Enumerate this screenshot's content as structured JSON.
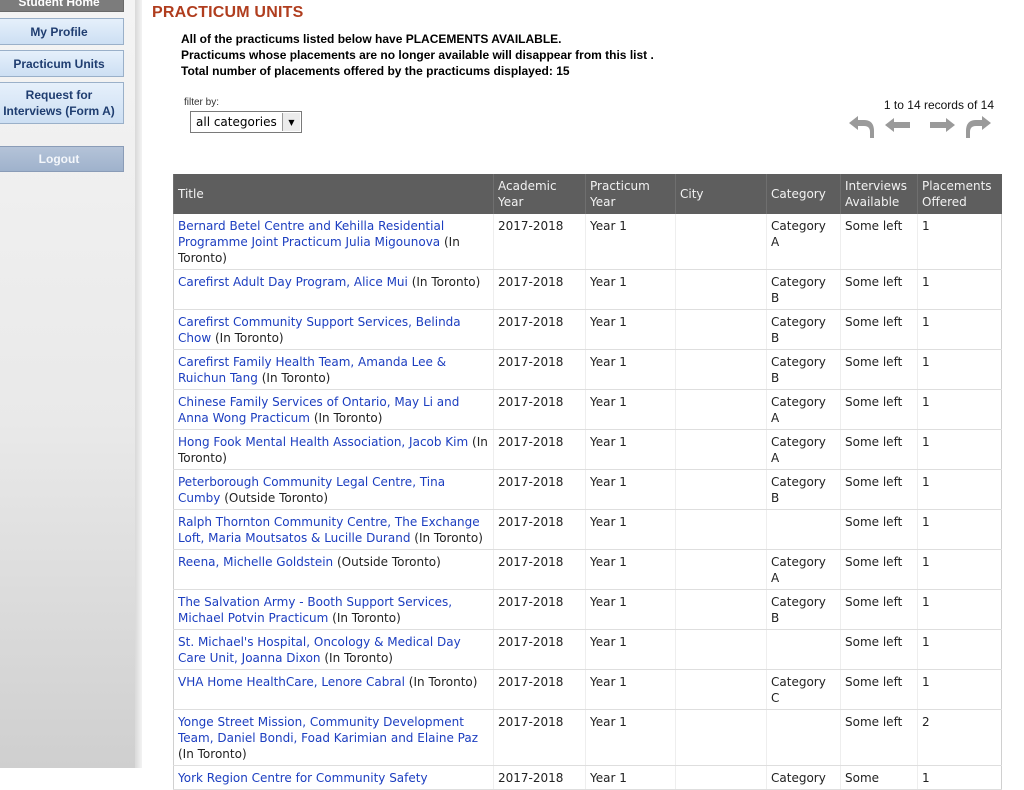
{
  "sidebar": {
    "items": [
      {
        "label": "Student Home"
      },
      {
        "label": "My Profile"
      },
      {
        "label": "Practicum Units"
      },
      {
        "label": "Request for Interviews (Form A)"
      },
      {
        "label": "Logout"
      }
    ]
  },
  "page": {
    "title": "PRACTICUM UNITS",
    "intro": [
      "All of the practicums listed below have PLACEMENTS AVAILABLE.",
      "Practicums whose placements are no longer available will disappear from this list .",
      "Total number of placements offered by the practicums displayed: 15"
    ]
  },
  "filter": {
    "label": "filter by:",
    "selected": "all categories"
  },
  "pager": {
    "records_text": "1 to 14 records of 14",
    "icons": [
      "first-page-icon",
      "previous-page-icon",
      "next-page-icon",
      "last-page-icon"
    ]
  },
  "table": {
    "headers": [
      "Title",
      "Academic Year",
      "Practicum Year",
      "City",
      "Category",
      "Interviews Available",
      "Placements Offered"
    ],
    "rows": [
      {
        "title": "Bernard Betel Centre and Kehilla Residential Programme Joint Practicum Julia Migounova",
        "location": "(In Toronto)",
        "academic_year": "2017-2018",
        "practicum_year": "Year 1",
        "city": "",
        "category": "Category A",
        "interviews": "Some left",
        "placements": "1"
      },
      {
        "title": "Carefirst Adult Day Program, Alice Mui",
        "location": "(In Toronto)",
        "academic_year": "2017-2018",
        "practicum_year": "Year 1",
        "city": "",
        "category": "Category B",
        "interviews": "Some left",
        "placements": "1"
      },
      {
        "title": "Carefirst Community Support Services, Belinda Chow",
        "location": "(In Toronto)",
        "academic_year": "2017-2018",
        "practicum_year": "Year 1",
        "city": "",
        "category": "Category B",
        "interviews": "Some left",
        "placements": "1"
      },
      {
        "title": "Carefirst Family Health Team, Amanda Lee & Ruichun Tang",
        "location": "(In Toronto)",
        "academic_year": "2017-2018",
        "practicum_year": "Year 1",
        "city": "",
        "category": "Category B",
        "interviews": "Some left",
        "placements": "1"
      },
      {
        "title": "Chinese Family Services of Ontario, May Li and Anna Wong Practicum",
        "location": "(In Toronto)",
        "academic_year": "2017-2018",
        "practicum_year": "Year 1",
        "city": "",
        "category": "Category A",
        "interviews": "Some left",
        "placements": "1"
      },
      {
        "title": "Hong Fook Mental Health Association, Jacob Kim",
        "location": "(In Toronto)",
        "academic_year": "2017-2018",
        "practicum_year": "Year 1",
        "city": "",
        "category": "Category A",
        "interviews": "Some left",
        "placements": "1"
      },
      {
        "title": "Peterborough Community Legal Centre, Tina Cumby",
        "location": "(Outside Toronto)",
        "academic_year": "2017-2018",
        "practicum_year": "Year 1",
        "city": "",
        "category": "Category B",
        "interviews": "Some left",
        "placements": "1"
      },
      {
        "title": "Ralph Thornton Community Centre, The Exchange Loft, Maria Moutsatos & Lucille Durand",
        "location": "(In Toronto)",
        "academic_year": "2017-2018",
        "practicum_year": "Year 1",
        "city": "",
        "category": "",
        "interviews": "Some left",
        "placements": "1"
      },
      {
        "title": "Reena, Michelle Goldstein",
        "location": "(Outside Toronto)",
        "academic_year": "2017-2018",
        "practicum_year": "Year 1",
        "city": "",
        "category": "Category A",
        "interviews": "Some left",
        "placements": "1"
      },
      {
        "title": "The Salvation Army - Booth Support Services, Michael Potvin Practicum",
        "location": "(In Toronto)",
        "academic_year": "2017-2018",
        "practicum_year": "Year 1",
        "city": "",
        "category": "Category B",
        "interviews": "Some left",
        "placements": "1"
      },
      {
        "title": "St. Michael's Hospital, Oncology & Medical Day Care Unit, Joanna Dixon",
        "location": "(In Toronto)",
        "academic_year": "2017-2018",
        "practicum_year": "Year 1",
        "city": "",
        "category": "",
        "interviews": "Some left",
        "placements": "1"
      },
      {
        "title": "VHA Home HealthCare, Lenore Cabral",
        "location": "(In Toronto)",
        "academic_year": "2017-2018",
        "practicum_year": "Year 1",
        "city": "",
        "category": "Category C",
        "interviews": "Some left",
        "placements": "1"
      },
      {
        "title": "Yonge Street Mission, Community Development Team, Daniel Bondi, Foad Karimian and Elaine Paz",
        "location": "(In Toronto)",
        "academic_year": "2017-2018",
        "practicum_year": "Year 1",
        "city": "",
        "category": "",
        "interviews": "Some left",
        "placements": "2"
      },
      {
        "title": "York Region Centre for Community Safety",
        "location": "",
        "academic_year": "2017-2018",
        "practicum_year": "Year 1",
        "city": "",
        "category": "Category",
        "interviews": "Some",
        "placements": "1"
      }
    ]
  }
}
